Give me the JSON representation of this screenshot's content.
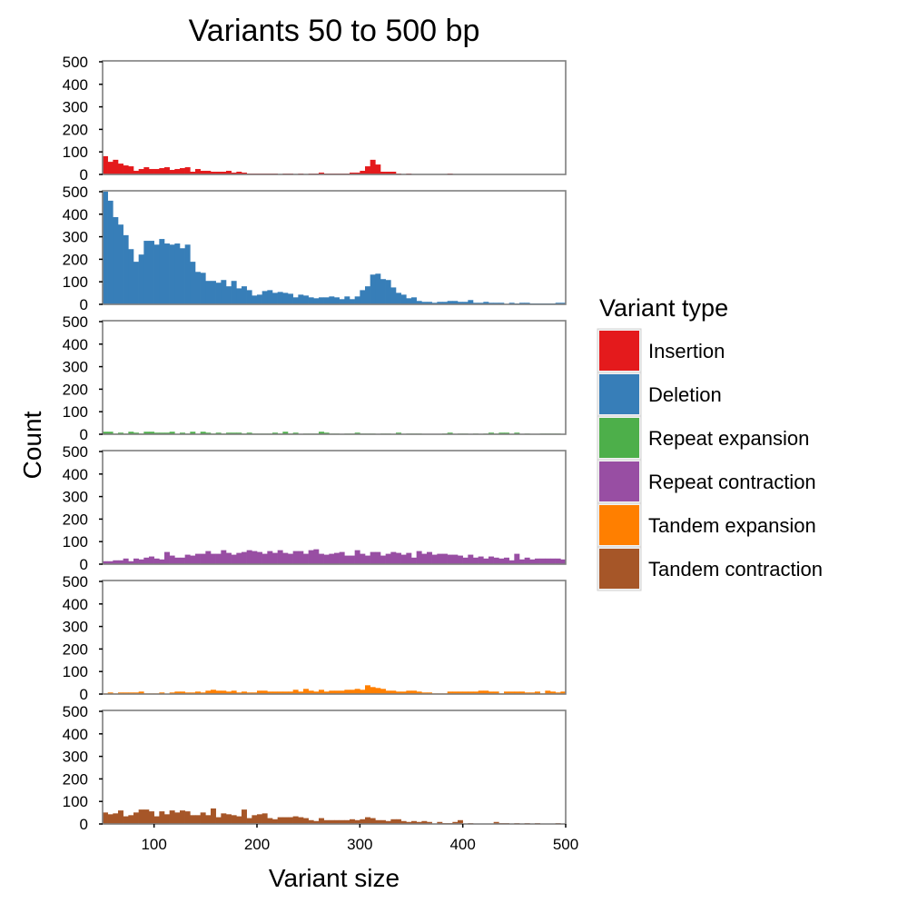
{
  "chart_data": {
    "type": "bar",
    "subtype": "faceted histogram",
    "title": "Variants 50 to 500 bp",
    "xlabel": "Variant size",
    "ylabel": "Count",
    "xlim": [
      50,
      500
    ],
    "ylim": [
      0,
      500
    ],
    "bin_width": 5,
    "x_ticks": [
      100,
      200,
      300,
      400,
      500
    ],
    "y_ticks": [
      0,
      100,
      200,
      300,
      400,
      500
    ],
    "grid": false,
    "legend": {
      "title": "Variant type",
      "position": "right"
    },
    "series": [
      {
        "name": "Insertion",
        "color": "#E41A1C",
        "values": [
          81,
          56,
          65,
          48,
          40,
          36,
          16,
          24,
          32,
          24,
          24,
          28,
          32,
          20,
          24,
          28,
          32,
          12,
          24,
          16,
          16,
          12,
          12,
          12,
          16,
          8,
          12,
          8,
          4,
          4,
          4,
          4,
          4,
          4,
          0,
          4,
          4,
          0,
          4,
          0,
          4,
          4,
          8,
          4,
          4,
          4,
          4,
          4,
          8,
          8,
          16,
          36,
          65,
          44,
          12,
          12,
          12,
          4,
          0,
          4,
          0,
          0,
          0,
          0,
          0,
          0,
          0,
          4,
          0,
          0,
          0,
          0,
          0,
          0,
          0,
          0,
          0,
          0,
          0,
          0,
          0,
          0,
          0,
          0,
          0,
          0,
          0,
          0,
          0,
          0
        ]
      },
      {
        "name": "Deletion",
        "color": "#377EB8",
        "values": [
          500,
          460,
          387,
          354,
          307,
          245,
          189,
          221,
          282,
          282,
          265,
          290,
          270,
          265,
          270,
          249,
          265,
          189,
          144,
          140,
          104,
          104,
          96,
          108,
          80,
          104,
          71,
          80,
          63,
          39,
          43,
          59,
          63,
          51,
          55,
          51,
          47,
          31,
          43,
          39,
          31,
          27,
          31,
          31,
          35,
          31,
          23,
          35,
          23,
          35,
          63,
          80,
          132,
          136,
          112,
          108,
          75,
          51,
          43,
          27,
          31,
          15,
          11,
          11,
          7,
          11,
          11,
          15,
          15,
          11,
          11,
          19,
          7,
          7,
          11,
          7,
          7,
          7,
          0,
          7,
          4,
          7,
          7,
          4,
          4,
          4,
          4,
          4,
          7,
          7
        ]
      },
      {
        "name": "Repeat expansion",
        "color": "#4DAF4A",
        "values": [
          11,
          11,
          3,
          7,
          3,
          11,
          7,
          3,
          11,
          11,
          7,
          7,
          7,
          11,
          0,
          7,
          3,
          11,
          0,
          11,
          7,
          3,
          7,
          3,
          7,
          7,
          7,
          3,
          7,
          3,
          3,
          3,
          3,
          7,
          3,
          11,
          3,
          7,
          0,
          3,
          3,
          3,
          11,
          7,
          3,
          3,
          0,
          3,
          3,
          7,
          3,
          3,
          3,
          0,
          3,
          3,
          0,
          7,
          0,
          3,
          3,
          3,
          0,
          0,
          0,
          0,
          3,
          7,
          0,
          3,
          3,
          0,
          3,
          0,
          3,
          7,
          3,
          7,
          7,
          0,
          7,
          0,
          3,
          0,
          0,
          3,
          3,
          3,
          3,
          0
        ]
      },
      {
        "name": "Repeat contraction",
        "color": "#984EA3",
        "values": [
          13,
          13,
          17,
          17,
          25,
          13,
          25,
          21,
          29,
          34,
          25,
          21,
          54,
          38,
          29,
          29,
          42,
          38,
          46,
          46,
          58,
          46,
          46,
          62,
          50,
          42,
          50,
          54,
          62,
          58,
          54,
          46,
          58,
          50,
          62,
          50,
          46,
          58,
          58,
          46,
          62,
          66,
          46,
          42,
          46,
          50,
          54,
          38,
          38,
          62,
          46,
          38,
          54,
          54,
          38,
          46,
          54,
          50,
          42,
          50,
          29,
          58,
          46,
          54,
          42,
          46,
          46,
          42,
          42,
          38,
          29,
          42,
          29,
          34,
          25,
          34,
          29,
          25,
          29,
          17,
          46,
          21,
          29,
          21,
          25,
          25,
          25,
          25,
          25,
          21
        ]
      },
      {
        "name": "Tandem expansion",
        "color": "#FF7F00",
        "values": [
          3,
          7,
          3,
          7,
          7,
          7,
          7,
          11,
          3,
          3,
          3,
          7,
          0,
          7,
          11,
          11,
          7,
          7,
          11,
          7,
          15,
          19,
          15,
          15,
          11,
          15,
          7,
          11,
          7,
          7,
          15,
          15,
          11,
          11,
          11,
          11,
          11,
          19,
          11,
          23,
          15,
          11,
          19,
          11,
          15,
          15,
          15,
          19,
          19,
          23,
          19,
          39,
          31,
          27,
          23,
          15,
          15,
          11,
          11,
          15,
          15,
          11,
          7,
          7,
          3,
          3,
          3,
          11,
          11,
          11,
          11,
          11,
          11,
          15,
          15,
          11,
          11,
          3,
          11,
          11,
          11,
          11,
          7,
          7,
          11,
          3,
          15,
          11,
          7,
          11
        ]
      },
      {
        "name": "Tandem contraction",
        "color": "#A65628",
        "values": [
          51,
          43,
          47,
          60,
          34,
          39,
          51,
          64,
          64,
          56,
          34,
          56,
          43,
          60,
          51,
          60,
          56,
          39,
          39,
          51,
          39,
          69,
          30,
          47,
          43,
          39,
          34,
          64,
          26,
          39,
          43,
          47,
          26,
          21,
          30,
          30,
          30,
          34,
          30,
          26,
          17,
          13,
          26,
          17,
          17,
          17,
          17,
          17,
          21,
          17,
          21,
          30,
          26,
          17,
          17,
          13,
          21,
          21,
          13,
          9,
          13,
          9,
          13,
          9,
          0,
          9,
          4,
          4,
          9,
          17,
          0,
          4,
          0,
          0,
          0,
          0,
          9,
          4,
          4,
          0,
          4,
          0,
          4,
          0,
          4,
          0,
          0,
          0,
          4,
          0
        ]
      }
    ]
  }
}
